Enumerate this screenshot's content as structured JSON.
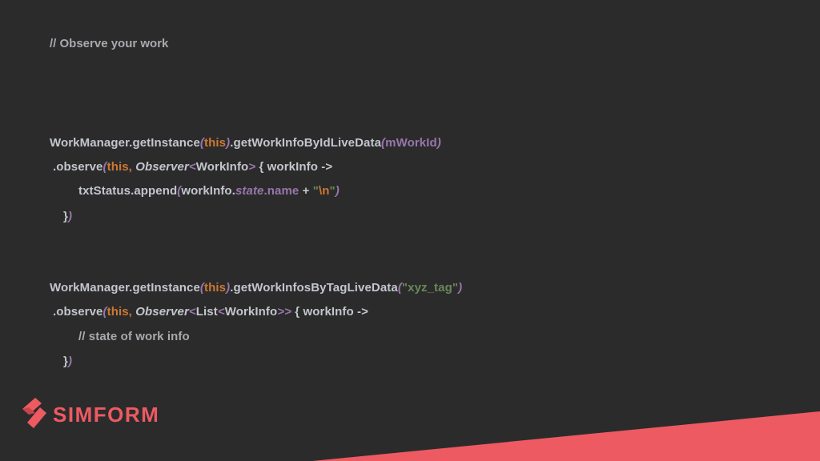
{
  "slide": {
    "header_comment": "// Observe your work",
    "block1": {
      "line1": {
        "a": "WorkManager.getInstance",
        "b": "(",
        "c": "this",
        "d": ")",
        "e": ".getWorkInfoByIdLiveData",
        "f": "(",
        "g": "mWorkId",
        "h": ")"
      },
      "line2": {
        "a": ".observe",
        "b": "(",
        "c": "this, ",
        "d": "Observer",
        "e": "<",
        "f": "WorkInfo",
        "g": ">",
        "h": " { workInfo ->"
      },
      "line3": {
        "a": "txtStatus.append",
        "b": "(",
        "c": "workInfo.",
        "d": "state",
        "e": ".name",
        "f": " + ",
        "g": "\"",
        "h": "\\n",
        "i": "\"",
        "j": ")"
      },
      "line4": {
        "a": "}",
        "b": ")"
      }
    },
    "block2": {
      "line1": {
        "a": "WorkManager.getInstance",
        "b": "(",
        "c": "this",
        "d": ")",
        "e": ".getWorkInfosByTagLiveData",
        "f": "(",
        "g": "\"xyz_tag\"",
        "h": ")"
      },
      "line2": {
        "a": ".observe",
        "b": "(",
        "c": "this, ",
        "d": "Observer",
        "e": "<",
        "f": "List",
        "g": "<",
        "h": "WorkInfo",
        "i": ">>",
        "j": " { workInfo ->"
      },
      "line3": {
        "a": "// state of work info"
      },
      "line4": {
        "a": "}",
        "b": ")"
      }
    }
  },
  "brand": {
    "name": "SIMFORM",
    "logo_icon": "simform-chevron-icon",
    "accent_color": "#ee5a62",
    "background_color": "#2b2b2c"
  }
}
